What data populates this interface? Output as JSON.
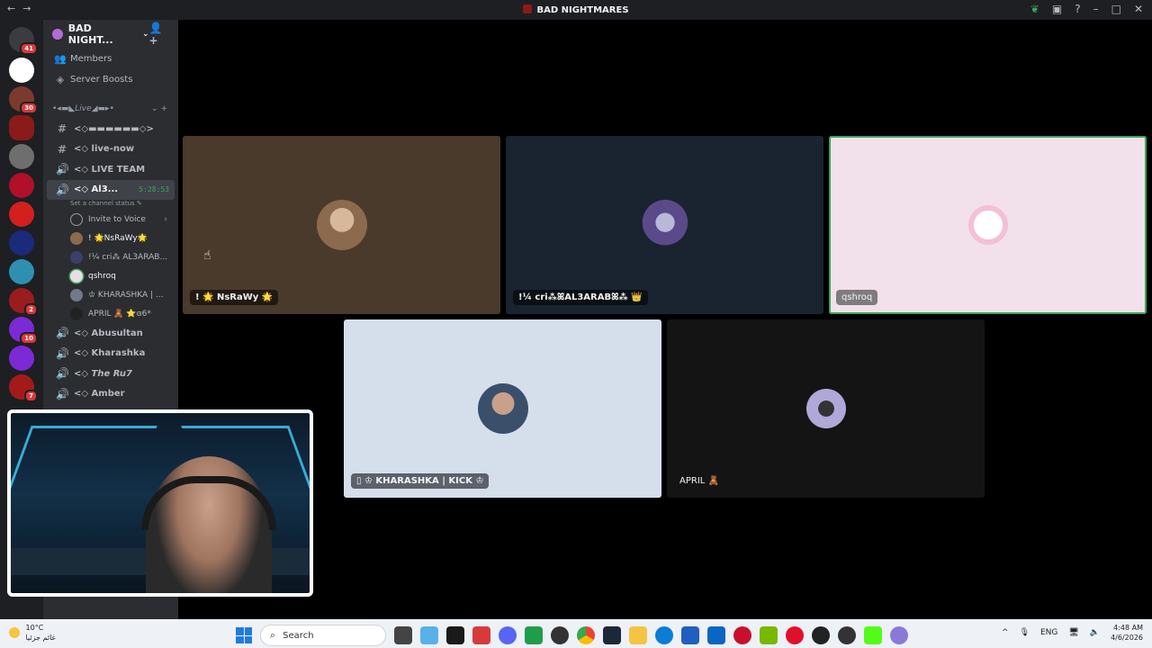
{
  "window": {
    "title": "BAD NIGHTMARES"
  },
  "guilds": [
    {
      "badge": "41",
      "color": "#3a3c42"
    },
    {
      "badge": "",
      "color": "#ffffff"
    },
    {
      "badge": "30",
      "color": "#7a3b2e"
    },
    {
      "badge": "",
      "color": "#8b1a1a"
    },
    {
      "badge": "",
      "color": "#6e6e6e"
    },
    {
      "badge": "",
      "color": "#b0102a"
    },
    {
      "badge": "",
      "color": "#d41f1f"
    },
    {
      "badge": "",
      "color": "#1b2a7a"
    },
    {
      "badge": "",
      "color": "#2f8fb0"
    },
    {
      "badge": "2",
      "color": "#9b1c1c"
    },
    {
      "badge": "10",
      "color": "#7b2ad6"
    },
    {
      "badge": "",
      "color": "#7b2ad6"
    },
    {
      "badge": "7",
      "color": "#a41a1a"
    }
  ],
  "server": {
    "name": "BAD NIGHT..."
  },
  "links": {
    "members": "Members",
    "boosts": "Server Boosts"
  },
  "category": {
    "name": "•◂▬◣Live◢▬▸•"
  },
  "channels": {
    "ch1": "<◇▬▬▬▬▬▬◇>",
    "ch2": "<◇ live-now",
    "ch3": "<◇ LIVE TEAM",
    "active": "<◇ Al3...",
    "active_timer": "5:28:53",
    "status_hint": "Set a channel status ✎",
    "invite": "Invite to Voice",
    "ch5": "<◇ Abusultan",
    "ch6": "<◇ Kharashka",
    "ch7": "<◇ The Ru7",
    "ch8": "<◇ Amber"
  },
  "voice_members": [
    {
      "name": "! 🌟NsRaWy🌟",
      "color": "#7a5a40"
    },
    {
      "name": "!¼ cri⁂ AL3ARAB...",
      "color": "#3b3f6a"
    },
    {
      "name": "qshroq",
      "color": "#e9dde6"
    },
    {
      "name": "♔ KHARASHKA | ...",
      "color": "#6f7a8a"
    },
    {
      "name": "APRIL 🧸 ⭐ɞ6*",
      "color": "#222"
    }
  ],
  "tiles": [
    {
      "label": "! 🌟 NsRaWy 🌟",
      "bg": "#4a3a2b",
      "av": "#8c6a4e"
    },
    {
      "label": "!¼ cri⁂ꕤAL3ARABꕤ⁂ 👑",
      "bg": "#1a2430",
      "av": "#5a4a8a"
    },
    {
      "label": "qshroq",
      "bg": "#f2e1ea",
      "av": "#ffffff"
    },
    {
      "label": "▯ ♔ KHARASHKA | KICK ♔",
      "bg": "#d5dfec",
      "av": "#3a4f6a"
    },
    {
      "label": "APRIL 🧸",
      "bg": "#141414",
      "av": "#6a5a8a"
    }
  ],
  "taskbar": {
    "weather_temp": "10°C",
    "weather_desc": "غائم جزئيا",
    "search_placeholder": "Search",
    "lang": "ENG",
    "time": "4:48 AM",
    "date": "4/6/2026"
  }
}
